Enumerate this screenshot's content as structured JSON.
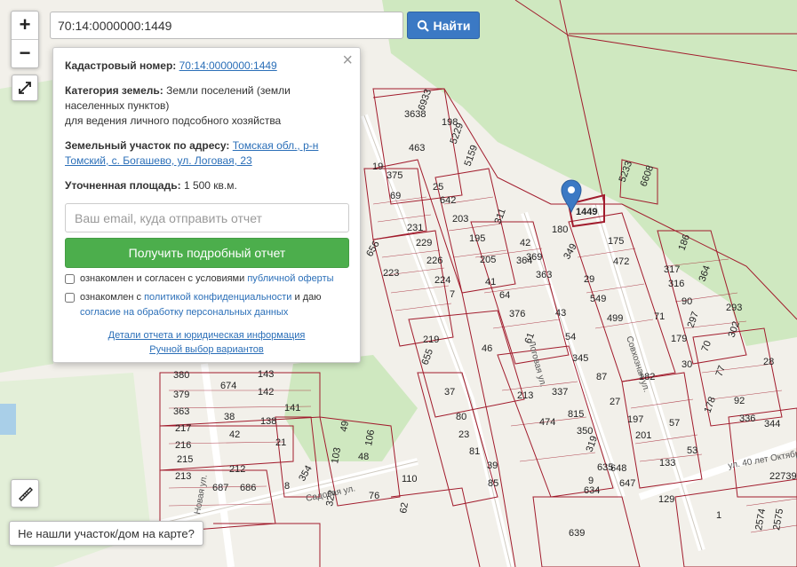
{
  "search": {
    "value": "70:14:0000000:1449"
  },
  "toolbar": {
    "find_label": "Найти",
    "zoom_in": "+",
    "zoom_out": "−"
  },
  "colors": {
    "accent": "#3b79c4",
    "cta": "#4cae4c",
    "parcel_stroke": "#a11b2c",
    "forest": "#cfe8c0",
    "link": "#2b6fb8"
  },
  "icons": {
    "search": "search-icon",
    "expand": "expand-icon",
    "ruler": "ruler-icon",
    "close": "close-icon",
    "marker": "map-marker-icon"
  },
  "info_panel": {
    "cadastral_label": "Кадастровый номер:",
    "cadastral_value": "70:14:0000000:1449",
    "category_label": "Категория земель:",
    "category_value": "Земли поселений (земли населенных пунктов)",
    "category_usage": "для ведения личного подсобного хозяйства",
    "address_label": "Земельный участок по адресу:",
    "address_value": "Томская обл., р-н Томский, с. Богашево, ул. Логовая, 23",
    "area_label": "Уточненная площадь:",
    "area_value": "1 500 кв.м.",
    "email_placeholder": "Ваш email, куда отправить отчет",
    "get_report_label": "Получить подробный отчет",
    "consent1_text": "ознакомлен и согласен с условиями",
    "consent1_link": "публичной оферты",
    "consent2_text_a": "ознакомлен с",
    "consent2_link1": "политикой конфиденциальности",
    "consent2_text_b": "и даю",
    "consent2_link2": "согласие на обработку персональных данных",
    "details_link": "Детали отчета и юридическая информация",
    "manual_link": "Ручной выбор вариантов"
  },
  "not_found_label": "Не нашли участок/дом на карте?",
  "map": {
    "selected_parcel": "1449",
    "parcel_labels": [
      "5233",
      "6608",
      "175",
      "472",
      "186",
      "317",
      "364",
      "316",
      "293",
      "302",
      "28",
      "349",
      "29",
      "549",
      "499",
      "71",
      "179",
      "297",
      "90",
      "70",
      "182",
      "30",
      "77",
      "92",
      "178",
      "336",
      "344",
      "43",
      "54",
      "345",
      "87",
      "27",
      "197",
      "201",
      "133",
      "57",
      "53",
      "337",
      "474",
      "815",
      "350",
      "319",
      "648",
      "647",
      "129",
      "635",
      "634",
      "639",
      "22739",
      "2574",
      "2575",
      "1",
      "143",
      "142",
      "138",
      "141",
      "674",
      "380",
      "379",
      "363",
      "38",
      "42",
      "217",
      "216",
      "215",
      "213",
      "212",
      "687",
      "686",
      "8",
      "354",
      "322",
      "103",
      "48",
      "106",
      "49",
      "110",
      "76",
      "62",
      "21",
      "81",
      "85",
      "39",
      "213",
      "80",
      "37",
      "23",
      "655",
      "219",
      "46",
      "376",
      "61",
      "364",
      "369",
      "363",
      "205",
      "195",
      "203",
      "41",
      "64",
      "7",
      "224",
      "226",
      "229",
      "231",
      "223",
      "656",
      "25",
      "642",
      "69",
      "375",
      "19",
      "3638",
      "6933",
      "198",
      "463",
      "5229",
      "5159",
      "311",
      "42",
      "180",
      "9"
    ],
    "street_labels": [
      "Логовая ул.",
      "Новая ул.",
      "ул. 40 лет Октября",
      "Садовая ул.",
      "Совхозная ул."
    ]
  }
}
